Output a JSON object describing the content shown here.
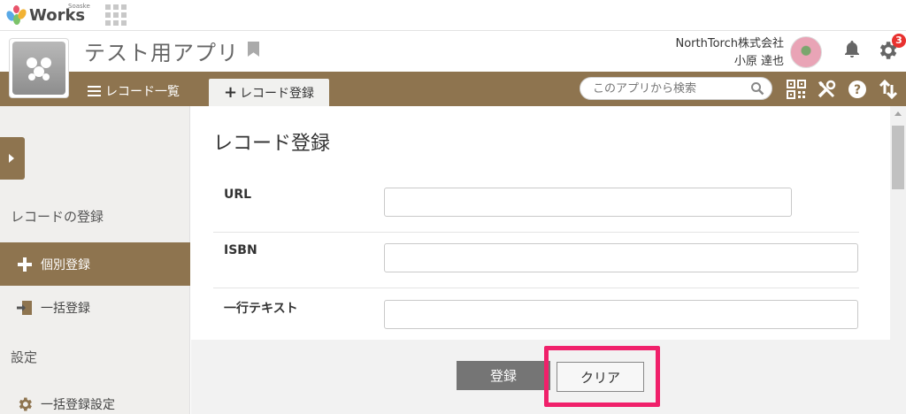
{
  "topbar": {
    "logo_sub": "Soaske",
    "logo_text": "Works",
    "app_grid_icon": "apps-grid-icon"
  },
  "header": {
    "app_title": "テスト用アプリ",
    "company": "NorthTorch株式会社",
    "user_name": "小原 達也",
    "notification_badge": "3"
  },
  "nav": {
    "record_list": "レコード一覧",
    "record_register": "レコード登録",
    "search_placeholder": "このアプリから検索"
  },
  "sidebar": {
    "section_register": "レコードの登録",
    "item_individual": "個別登録",
    "item_bulk": "一括登録",
    "section_settings": "設定",
    "item_bulk_settings": "一括登録設定"
  },
  "main": {
    "title": "レコード登録",
    "fields": [
      {
        "label": "URL",
        "value": ""
      },
      {
        "label": "ISBN",
        "value": ""
      },
      {
        "label": "一行テキスト",
        "value": ""
      }
    ]
  },
  "footer": {
    "register_button": "登録",
    "clear_button": "クリア"
  },
  "colors": {
    "brand": "#8e744f",
    "highlight": "#f0206a",
    "badge": "#e8312f"
  }
}
